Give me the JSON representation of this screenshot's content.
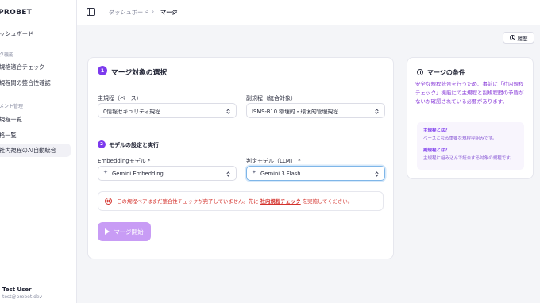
{
  "sidebar": {
    "brand": "PROBET",
    "items": [
      {
        "label": "ッシュボード"
      },
      {
        "label": "ク機能",
        "section": true
      },
      {
        "label": "規格適合チェック"
      },
      {
        "label": "規程間の整合性確認"
      },
      {
        "label": "メント管理",
        "section": true
      },
      {
        "label": "規程一覧"
      },
      {
        "label": "格一覧"
      },
      {
        "label": "社内規程のAI自動統合",
        "active": true
      }
    ],
    "user": {
      "name": "Test User",
      "email": "test@probet.dev"
    }
  },
  "header": {
    "breadcrumb": [
      "ダッシュボード",
      "マージ"
    ],
    "separator": "›"
  },
  "history_button": {
    "label": "履歴"
  },
  "merge_card": {
    "step1": {
      "number": "1",
      "title": "マージ対象の選択"
    },
    "main_rule": {
      "label": "主規程（ベース）",
      "value": "0情報セキュリティ規程"
    },
    "sub_rule": {
      "label": "副規程（統合対象）",
      "value": "ISMS-B10 物理的・環境的管理規程"
    },
    "step2": {
      "number": "2",
      "title": "モデルの設定と実行"
    },
    "embedding_model": {
      "label": "Embeddingモデル *",
      "value": "Gemini Embedding"
    },
    "judge_model": {
      "label": "判定モデル（LLM） *",
      "value": "Gemini 3 Flash"
    },
    "alert": {
      "text_before": "この規程ペアはまだ整合性チェックが完了していません。先に",
      "link": "社内規程チェック",
      "text_after": "を実施してください。"
    },
    "merge_button": {
      "label": "マージ開始"
    }
  },
  "conditions": {
    "title": "マージの条件",
    "description": "安全な規程統合を行うため、事前に「社内規程チェック」機能にて主規程と副規程間の矛盾がないか確認されている必要があります。",
    "terms": [
      {
        "term": "主規程とは？",
        "definition": "ベースとなる重要な規程枠組みです。"
      },
      {
        "term": "副規程とは？",
        "definition": "主規程に組み込んで統合する対象の規程です。"
      }
    ]
  },
  "colors": {
    "accent": "#7c3aed",
    "accent_light": "#c89cf5",
    "error": "#d4322c",
    "background": "#f4f5f8"
  }
}
